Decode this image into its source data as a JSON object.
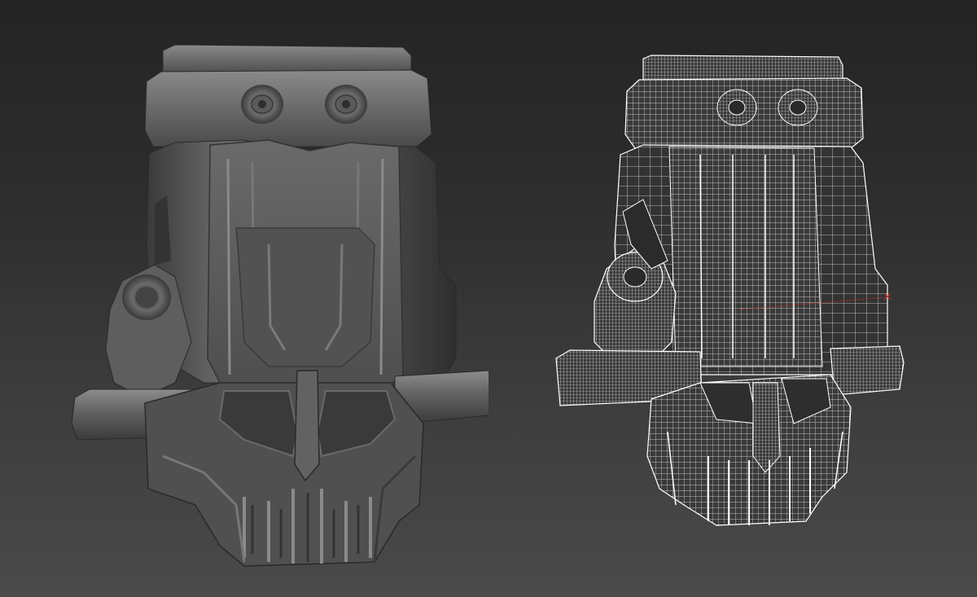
{
  "viewport": {
    "background_top": "#242424",
    "background_bottom": "#4a4a4a"
  },
  "models": [
    {
      "name": "shaded-model",
      "render_mode": "smooth-shaded",
      "base_color": "#5a5a5a"
    },
    {
      "name": "wireframe-model",
      "render_mode": "shaded-with-wireframe",
      "base_color": "#3a3a3a",
      "wire_color": "#ffffff"
    }
  ],
  "gizmo": {
    "axis_color": "#c83030"
  }
}
